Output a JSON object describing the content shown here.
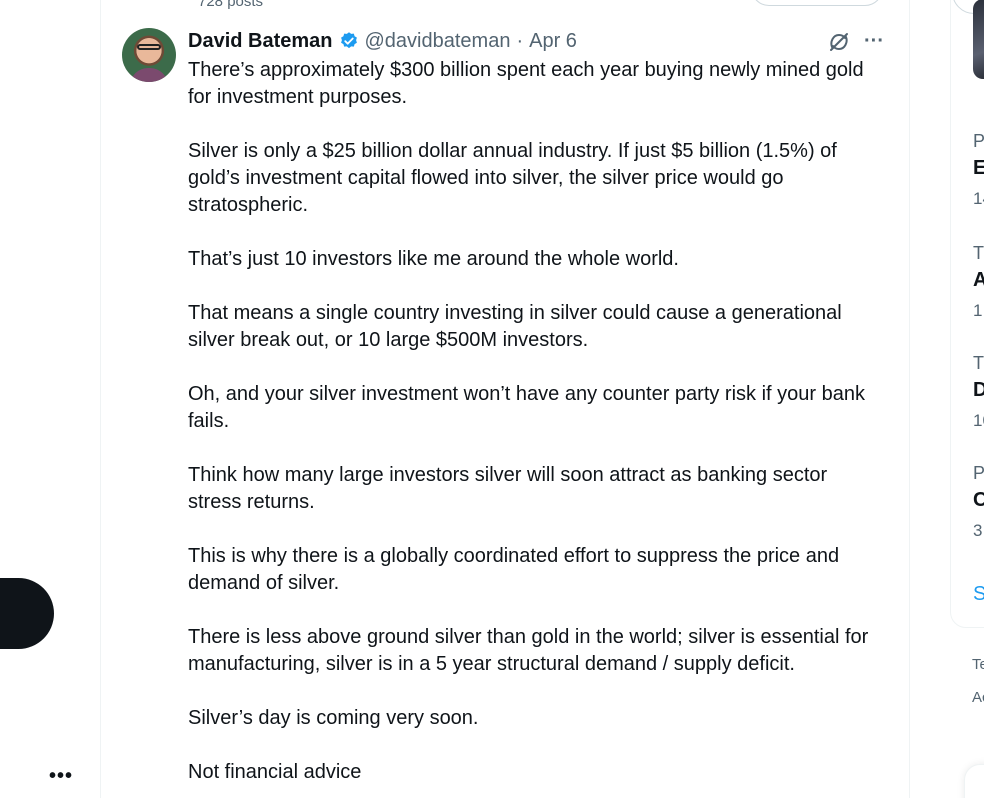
{
  "profile_header": {
    "post_count": "728 posts"
  },
  "tweet": {
    "name": "David Bateman",
    "handle": "@davidbateman",
    "separator": "·",
    "date": "Apr 6",
    "paragraphs": [
      "There’s approximately $300 billion spent each year buying newly mined gold for investment purposes.",
      "Silver is only a $25 billion dollar annual industry. If just $5 billion (1.5%) of gold’s investment capital flowed into silver, the silver price would go stratospheric.",
      "That’s just 10 investors like me around the whole world.",
      "That means a single country investing in silver could cause a generational silver break out, or 10 large $500M investors.",
      "Oh, and your silver investment won’t have any counter party risk if your bank fails.",
      "Think how many large investors silver will soon attract as banking sector stress returns.",
      "This is why there is a globally coordinated effort to suppress the price and demand of silver.",
      "There is less above ground silver than gold in the world; silver is essential for manufacturing, silver is in a 5 year structural demand / supply deficit.",
      "Silver’s day is coming very soon.",
      "Not financial advice"
    ]
  },
  "sidebar_trends": [
    {
      "category": "P",
      "title": "E",
      "count": "14"
    },
    {
      "category": "T",
      "title": "A",
      "count": "1,"
    },
    {
      "category": "T",
      "title": "D",
      "count": "10"
    },
    {
      "category": "P",
      "title": "C",
      "count": "3"
    }
  ],
  "sidebar": {
    "show_more": "S",
    "footer_line1": "Te",
    "footer_line2": "Ac"
  },
  "icons": {
    "verified": "verified-badge-icon",
    "grok": "grok-icon",
    "more": "more-horizontal-icon"
  },
  "colors": {
    "accent": "#1d9bf0",
    "text": "#0f1419",
    "secondary": "#536471",
    "fab": "#0f1419"
  }
}
